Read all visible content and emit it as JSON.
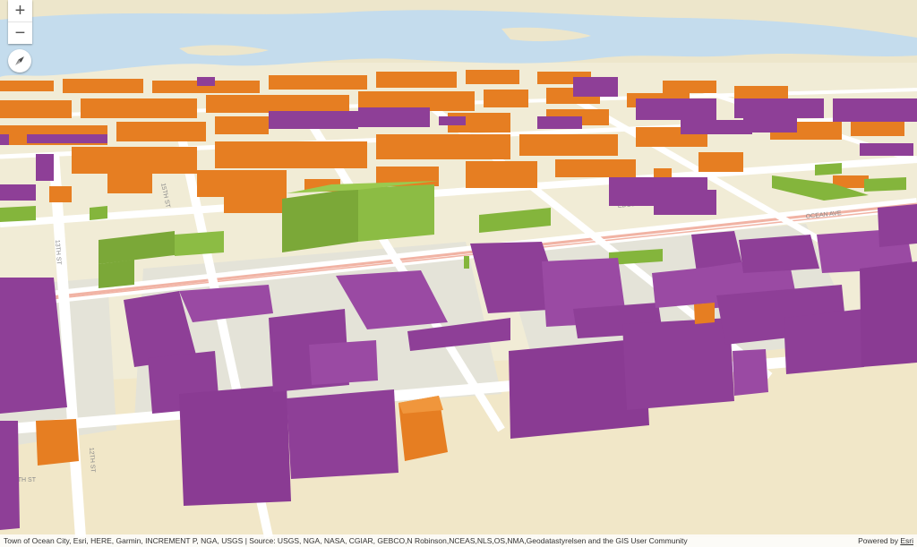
{
  "map": {
    "controls": {
      "zoom_in_label": "+",
      "zoom_out_label": "−",
      "compass_icon": "compass-icon"
    },
    "attribution": {
      "text": "Town of Ocean City, Esri, HERE, Garmin, INCREMENT P, NGA, USGS | Source: USGS, NGA, NASA, CGIAR, GEBCO,N Robinson,NCEAS,NLS,OS,NMA,Geodatastyrelsen and the GIS User Community",
      "powered_prefix": "Powered by ",
      "powered_link": "Esri"
    },
    "street_labels": [
      "12TH ST",
      "13TH ST",
      "15TH ST",
      "14TH ST",
      "EDGEWATER AVE",
      "OCEAN AVE",
      "12TH ST",
      "16TH ST"
    ],
    "colors": {
      "residential": "#e67e22",
      "commercial": "#8e3f97",
      "public": "#84b53c",
      "water": "#c4dced",
      "land": "#f1ecd6",
      "road_major": "#f1b3a4"
    }
  }
}
